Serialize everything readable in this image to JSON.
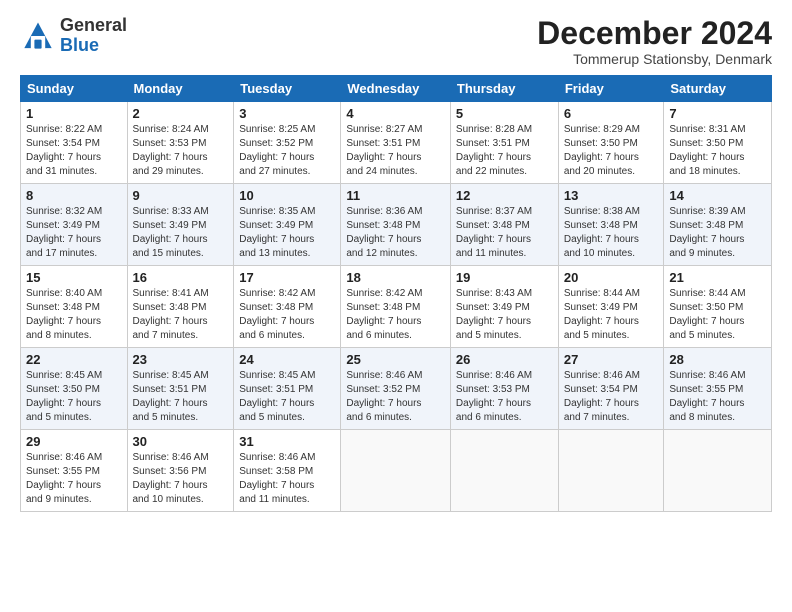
{
  "logo": {
    "general": "General",
    "blue": "Blue"
  },
  "header": {
    "title": "December 2024",
    "subtitle": "Tommerup Stationsby, Denmark"
  },
  "weekdays": [
    "Sunday",
    "Monday",
    "Tuesday",
    "Wednesday",
    "Thursday",
    "Friday",
    "Saturday"
  ],
  "weeks": [
    [
      {
        "day": "1",
        "info": "Sunrise: 8:22 AM\nSunset: 3:54 PM\nDaylight: 7 hours\nand 31 minutes."
      },
      {
        "day": "2",
        "info": "Sunrise: 8:24 AM\nSunset: 3:53 PM\nDaylight: 7 hours\nand 29 minutes."
      },
      {
        "day": "3",
        "info": "Sunrise: 8:25 AM\nSunset: 3:52 PM\nDaylight: 7 hours\nand 27 minutes."
      },
      {
        "day": "4",
        "info": "Sunrise: 8:27 AM\nSunset: 3:51 PM\nDaylight: 7 hours\nand 24 minutes."
      },
      {
        "day": "5",
        "info": "Sunrise: 8:28 AM\nSunset: 3:51 PM\nDaylight: 7 hours\nand 22 minutes."
      },
      {
        "day": "6",
        "info": "Sunrise: 8:29 AM\nSunset: 3:50 PM\nDaylight: 7 hours\nand 20 minutes."
      },
      {
        "day": "7",
        "info": "Sunrise: 8:31 AM\nSunset: 3:50 PM\nDaylight: 7 hours\nand 18 minutes."
      }
    ],
    [
      {
        "day": "8",
        "info": "Sunrise: 8:32 AM\nSunset: 3:49 PM\nDaylight: 7 hours\nand 17 minutes."
      },
      {
        "day": "9",
        "info": "Sunrise: 8:33 AM\nSunset: 3:49 PM\nDaylight: 7 hours\nand 15 minutes."
      },
      {
        "day": "10",
        "info": "Sunrise: 8:35 AM\nSunset: 3:49 PM\nDaylight: 7 hours\nand 13 minutes."
      },
      {
        "day": "11",
        "info": "Sunrise: 8:36 AM\nSunset: 3:48 PM\nDaylight: 7 hours\nand 12 minutes."
      },
      {
        "day": "12",
        "info": "Sunrise: 8:37 AM\nSunset: 3:48 PM\nDaylight: 7 hours\nand 11 minutes."
      },
      {
        "day": "13",
        "info": "Sunrise: 8:38 AM\nSunset: 3:48 PM\nDaylight: 7 hours\nand 10 minutes."
      },
      {
        "day": "14",
        "info": "Sunrise: 8:39 AM\nSunset: 3:48 PM\nDaylight: 7 hours\nand 9 minutes."
      }
    ],
    [
      {
        "day": "15",
        "info": "Sunrise: 8:40 AM\nSunset: 3:48 PM\nDaylight: 7 hours\nand 8 minutes."
      },
      {
        "day": "16",
        "info": "Sunrise: 8:41 AM\nSunset: 3:48 PM\nDaylight: 7 hours\nand 7 minutes."
      },
      {
        "day": "17",
        "info": "Sunrise: 8:42 AM\nSunset: 3:48 PM\nDaylight: 7 hours\nand 6 minutes."
      },
      {
        "day": "18",
        "info": "Sunrise: 8:42 AM\nSunset: 3:48 PM\nDaylight: 7 hours\nand 6 minutes."
      },
      {
        "day": "19",
        "info": "Sunrise: 8:43 AM\nSunset: 3:49 PM\nDaylight: 7 hours\nand 5 minutes."
      },
      {
        "day": "20",
        "info": "Sunrise: 8:44 AM\nSunset: 3:49 PM\nDaylight: 7 hours\nand 5 minutes."
      },
      {
        "day": "21",
        "info": "Sunrise: 8:44 AM\nSunset: 3:50 PM\nDaylight: 7 hours\nand 5 minutes."
      }
    ],
    [
      {
        "day": "22",
        "info": "Sunrise: 8:45 AM\nSunset: 3:50 PM\nDaylight: 7 hours\nand 5 minutes."
      },
      {
        "day": "23",
        "info": "Sunrise: 8:45 AM\nSunset: 3:51 PM\nDaylight: 7 hours\nand 5 minutes."
      },
      {
        "day": "24",
        "info": "Sunrise: 8:45 AM\nSunset: 3:51 PM\nDaylight: 7 hours\nand 5 minutes."
      },
      {
        "day": "25",
        "info": "Sunrise: 8:46 AM\nSunset: 3:52 PM\nDaylight: 7 hours\nand 6 minutes."
      },
      {
        "day": "26",
        "info": "Sunrise: 8:46 AM\nSunset: 3:53 PM\nDaylight: 7 hours\nand 6 minutes."
      },
      {
        "day": "27",
        "info": "Sunrise: 8:46 AM\nSunset: 3:54 PM\nDaylight: 7 hours\nand 7 minutes."
      },
      {
        "day": "28",
        "info": "Sunrise: 8:46 AM\nSunset: 3:55 PM\nDaylight: 7 hours\nand 8 minutes."
      }
    ],
    [
      {
        "day": "29",
        "info": "Sunrise: 8:46 AM\nSunset: 3:55 PM\nDaylight: 7 hours\nand 9 minutes."
      },
      {
        "day": "30",
        "info": "Sunrise: 8:46 AM\nSunset: 3:56 PM\nDaylight: 7 hours\nand 10 minutes."
      },
      {
        "day": "31",
        "info": "Sunrise: 8:46 AM\nSunset: 3:58 PM\nDaylight: 7 hours\nand 11 minutes."
      },
      null,
      null,
      null,
      null
    ]
  ]
}
